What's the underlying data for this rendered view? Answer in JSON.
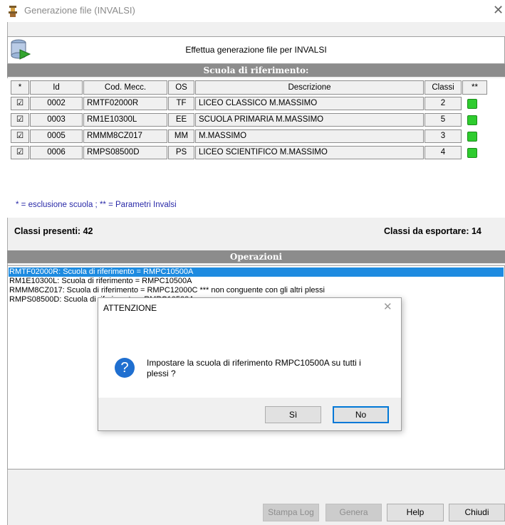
{
  "window": {
    "title": "Generazione file (INVALSI)",
    "close_glyph": "✕"
  },
  "header": {
    "text": "Effettua generazione file per INVALSI"
  },
  "section_school": {
    "title": "Scuola di riferimento:"
  },
  "table": {
    "columns": [
      "*",
      "Id",
      "Cod. Mecc.",
      "OS",
      "Descrizione",
      "Classi",
      "**"
    ],
    "rows": [
      {
        "checked": "☑",
        "id": "0002",
        "cod": "RMTF02000R",
        "os": "TF",
        "desc": "LICEO CLASSICO  M.MASSIMO",
        "classi": "2"
      },
      {
        "checked": "☑",
        "id": "0003",
        "cod": "RM1E10300L",
        "os": "EE",
        "desc": "SCUOLA PRIMARIA M.MASSIMO",
        "classi": "5"
      },
      {
        "checked": "☑",
        "id": "0005",
        "cod": "RMMM8CZ017",
        "os": "MM",
        "desc": "M.MASSIMO",
        "classi": "3"
      },
      {
        "checked": "☑",
        "id": "0006",
        "cod": "RMPS08500D",
        "os": "PS",
        "desc": "LICEO SCIENTIFICO M.MASSIMO",
        "classi": "4"
      }
    ],
    "status_color": "#2ecc2e"
  },
  "legend": "* = esclusione scuola ; ** = Parametri Invalsi",
  "summary": {
    "classi_presenti": "Classi presenti: 42",
    "classi_esportare": "Classi da esportare: 14"
  },
  "section_ops": {
    "title": "Operazioni"
  },
  "log": [
    "RMTF02000R: Scuola di riferimento = RMPC10500A",
    "RM1E10300L: Scuola di riferimento = RMPC10500A",
    "RMMM8CZ017: Scuola di riferimento = RMPC12000C *** non conguente con gli altri plessi",
    "RMPS08500D: Scuola di riferimento = RMPC10500A"
  ],
  "dialog": {
    "title": "ATTENZIONE",
    "close_glyph": "✕",
    "icon_glyph": "?",
    "message_line1": "Impostare la scuola di riferimento RMPC10500A su tutti i",
    "message_line2": "plessi ?",
    "yes_label": "Sì",
    "no_label": "No"
  },
  "buttons": {
    "stampa_log": "Stampa Log",
    "genera": "Genera",
    "help": "Help",
    "chiudi": "Chiudi"
  }
}
